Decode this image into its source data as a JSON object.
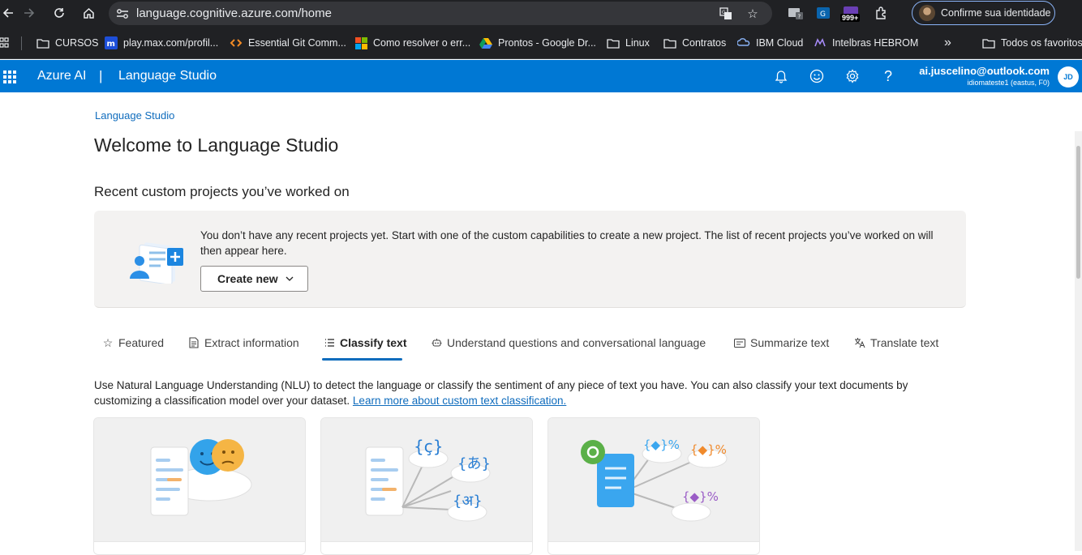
{
  "browser": {
    "url": "language.cognitive.azure.com/home",
    "profile_label": "Confirme sua identidade",
    "extension_badge": "999+",
    "bookmarks": [
      {
        "label": "CURSOS",
        "icon": "folder-icon"
      },
      {
        "label": "play.max.com/profil...",
        "icon": "max-icon"
      },
      {
        "label": "Essential Git Comm...",
        "icon": "code-icon"
      },
      {
        "label": "Como resolver o err...",
        "icon": "microsoft-icon"
      },
      {
        "label": "Prontos - Google Dr...",
        "icon": "google-drive-icon"
      },
      {
        "label": "Linux",
        "icon": "folder-icon"
      },
      {
        "label": "Contratos",
        "icon": "folder-icon"
      },
      {
        "label": "IBM Cloud",
        "icon": "ibm-icon"
      },
      {
        "label": "Intelbras HEBROM",
        "icon": "intelbras-icon"
      }
    ],
    "more_bookmarks": "»",
    "all_bookmarks": "Todos os favoritos"
  },
  "header": {
    "brand": "Azure AI",
    "separator": "|",
    "product": "Language Studio",
    "user_email": "ai.juscelino@outlook.com",
    "user_resource": "idiomateste1 (eastus, F0)",
    "avatar_initials": "JD",
    "accent_color": "#0078d4"
  },
  "page": {
    "breadcrumb": "Language Studio",
    "title": "Welcome to Language Studio",
    "recent_title": "Recent custom projects you’ve worked on",
    "empty_message": "You don’t have any recent projects yet. Start with one of the custom capabilities to create a new project. The list of recent projects you’ve worked on will then appear here.",
    "create_new_label": "Create new",
    "tabs": [
      {
        "label": "Featured",
        "icon": "star-icon"
      },
      {
        "label": "Extract information",
        "icon": "document-icon"
      },
      {
        "label": "Classify text",
        "icon": "list-icon",
        "active": true
      },
      {
        "label": "Understand questions and conversational language",
        "icon": "bot-icon"
      },
      {
        "label": "Summarize text",
        "icon": "summary-icon"
      },
      {
        "label": "Translate text",
        "icon": "translate-icon"
      }
    ],
    "description": "Use Natural Language Understanding (NLU) to detect the language or classify the sentiment of any piece of text you have. You can also classify your text documents by customizing a classification model over your dataset.",
    "description_link": "Learn more about custom text classification."
  }
}
